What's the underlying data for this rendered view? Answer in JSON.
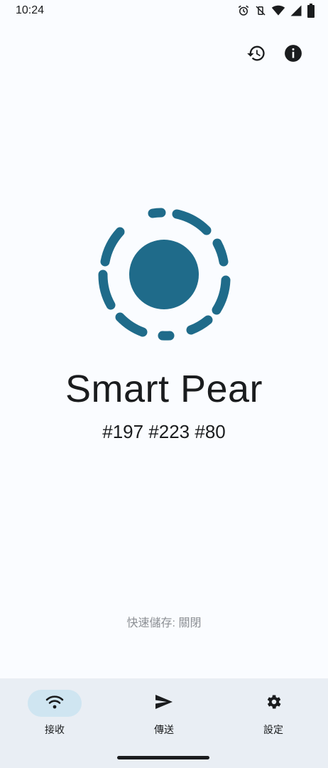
{
  "status_bar": {
    "time": "10:24",
    "icons": [
      "alarm-icon",
      "vibrate-off-icon",
      "wifi-icon",
      "signal-icon",
      "battery-icon"
    ]
  },
  "top_actions": {
    "history_icon": "history-icon",
    "info_icon": "info-icon"
  },
  "device": {
    "name": "Smart Pear",
    "tags": "#197 #223 #80",
    "logo_color": "#1f6b8a"
  },
  "quick_save": "快速儲存: 關閉",
  "bottom_nav": {
    "items": [
      {
        "label": "接收",
        "icon": "wifi-icon",
        "active": true
      },
      {
        "label": "傳送",
        "icon": "send-icon",
        "active": false
      },
      {
        "label": "設定",
        "icon": "gear-icon",
        "active": false
      }
    ]
  },
  "colors": {
    "accent": "#1f6b8a",
    "active_pill": "#cfe5f1",
    "nav_background": "#e9eef4",
    "background": "#fafcff"
  }
}
